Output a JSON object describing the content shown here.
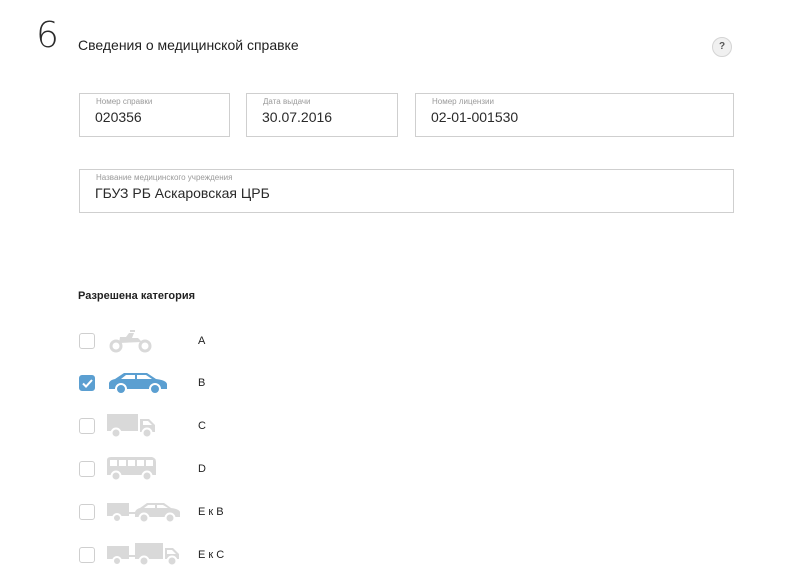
{
  "section": {
    "number": "6",
    "title": "Сведения о медицинской справке",
    "help_label": "?"
  },
  "fields": {
    "cert_number": {
      "label": "Номер справки",
      "value": "020356"
    },
    "issue_date": {
      "label": "Дата выдачи",
      "value": "30.07.2016"
    },
    "license_number": {
      "label": "Номер лицензии",
      "value": "02-01-001530"
    },
    "institution": {
      "label": "Название медицинского учреждения",
      "value": "ГБУЗ РБ Аскаровская ЦРБ"
    }
  },
  "categories": {
    "heading": "Разрешена категория",
    "items": [
      {
        "label": "A",
        "icon": "motorcycle-icon",
        "checked": false
      },
      {
        "label": "B",
        "icon": "car-icon",
        "checked": true
      },
      {
        "label": "C",
        "icon": "truck-icon",
        "checked": false
      },
      {
        "label": "D",
        "icon": "bus-icon",
        "checked": false
      },
      {
        "label": "E к B",
        "icon": "trailer-car-icon",
        "checked": false
      },
      {
        "label": "E к C",
        "icon": "trailer-truck-icon",
        "checked": false
      }
    ]
  },
  "colors": {
    "accent": "#5b9fd1",
    "inactive_icon": "#d9d9d9",
    "border": "#cfcfcf"
  }
}
